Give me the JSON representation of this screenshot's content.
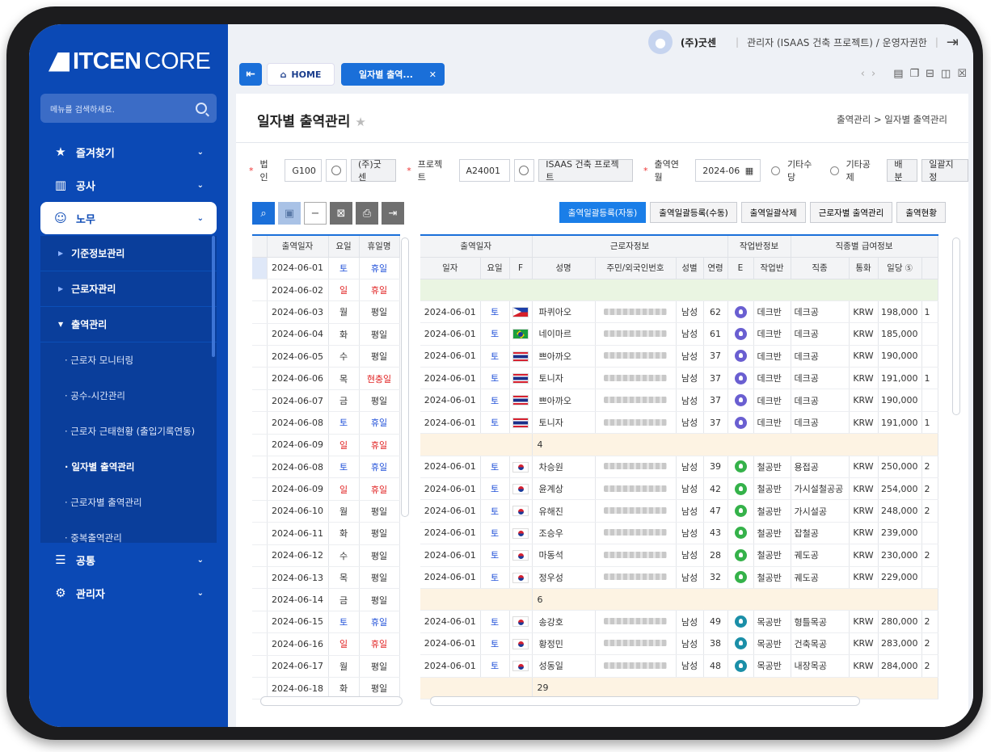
{
  "app": {
    "logo_main": "ITCEN",
    "logo_sub": "CORE"
  },
  "sidebar": {
    "search_placeholder": "메뉴를 검색하세요.",
    "items": [
      {
        "label": "즐겨찾기",
        "icon": "star-icon"
      },
      {
        "label": "공사",
        "icon": "building-icon"
      },
      {
        "label": "노무",
        "icon": "user-icon"
      },
      {
        "label": "공통",
        "icon": "common-icon"
      },
      {
        "label": "관리자",
        "icon": "folder-gear-icon"
      }
    ],
    "submenu": [
      {
        "label": "기준정보관리",
        "level": 1
      },
      {
        "label": "근로자관리",
        "level": 1
      },
      {
        "label": "출역관리",
        "level": 1,
        "open": true
      },
      {
        "label": "· 근로자 모니터링",
        "level": 2
      },
      {
        "label": "· 공수-시간관리",
        "level": 2
      },
      {
        "label": "· 근로자 근태현황 (출입기록연동)",
        "level": 2
      },
      {
        "label": "· 일자별 출역관리",
        "level": 2,
        "current": true
      },
      {
        "label": "· 근로자별 출역관리",
        "level": 2
      },
      {
        "label": "· 중복출역관리",
        "level": 2
      }
    ]
  },
  "topbar": {
    "company": "(주)굿센",
    "role": "관리자 (ISAAS 건축 프로젝트) / 운영자권한"
  },
  "tabs": {
    "home": "HOME",
    "active": "일자별 출역..."
  },
  "page": {
    "title": "일자별 출역관리",
    "breadcrumb": "출역관리 > 일자별 출역관리"
  },
  "filters": {
    "corp_label": "법인",
    "corp_code": "G100",
    "corp_name": "(주)굿센",
    "proj_label": "프로젝트",
    "proj_code": "A24001",
    "proj_name": "ISAAS 건축 프로젝트",
    "month_label": "출역연월",
    "month_value": "2024-06",
    "radio1": "기타수당",
    "radio2": "기타공제",
    "btn_distribute": "배분",
    "btn_bulk": "일괄지정"
  },
  "actions": [
    "출역일괄등록(자동)",
    "출역일괄등록(수동)",
    "출역일괄삭제",
    "근로자별 출역관리",
    "출역현황"
  ],
  "left_table": {
    "headers": [
      "출역일자",
      "요일",
      "휴일명"
    ],
    "rows": [
      [
        "2024-06-01",
        "토",
        "휴일"
      ],
      [
        "2024-06-02",
        "일",
        "휴일"
      ],
      [
        "2024-06-03",
        "월",
        "평일"
      ],
      [
        "2024-06-04",
        "화",
        "평일"
      ],
      [
        "2024-06-05",
        "수",
        "평일"
      ],
      [
        "2024-06-06",
        "목",
        "현충일"
      ],
      [
        "2024-06-07",
        "금",
        "평일"
      ],
      [
        "2024-06-08",
        "토",
        "휴일"
      ],
      [
        "2024-06-09",
        "일",
        "휴일"
      ],
      [
        "2024-06-08",
        "토",
        "휴일"
      ],
      [
        "2024-06-09",
        "일",
        "휴일"
      ],
      [
        "2024-06-10",
        "월",
        "평일"
      ],
      [
        "2024-06-11",
        "화",
        "평일"
      ],
      [
        "2024-06-12",
        "수",
        "평일"
      ],
      [
        "2024-06-13",
        "목",
        "평일"
      ],
      [
        "2024-06-14",
        "금",
        "평일"
      ],
      [
        "2024-06-15",
        "토",
        "휴일"
      ],
      [
        "2024-06-16",
        "일",
        "휴일"
      ],
      [
        "2024-06-17",
        "월",
        "평일"
      ],
      [
        "2024-06-18",
        "화",
        "평일"
      ]
    ]
  },
  "right_table": {
    "group_headers": [
      "출역일자",
      "근로자정보",
      "작업반정보",
      "직종별 급여정보"
    ],
    "headers": [
      "일자",
      "요일",
      "F",
      "성명",
      "주민/외국인번호",
      "성별",
      "연령",
      "E",
      "작업반",
      "직종",
      "통화",
      "일당"
    ],
    "rows": [
      {
        "type": "green"
      },
      {
        "type": "data",
        "date": "2024-06-01",
        "dow": "토",
        "flag": "ph",
        "name": "파퀴아오",
        "gender": "남성",
        "age": "62",
        "badge": "p",
        "team": "데크반",
        "job": "데크공",
        "cur": "KRW",
        "wage": "198,000",
        "extra": "1"
      },
      {
        "type": "data",
        "date": "2024-06-01",
        "dow": "토",
        "flag": "br",
        "name": "네이마르",
        "gender": "남성",
        "age": "61",
        "badge": "p",
        "team": "데크반",
        "job": "데크공",
        "cur": "KRW",
        "wage": "185,000",
        "extra": ""
      },
      {
        "type": "data",
        "date": "2024-06-01",
        "dow": "토",
        "flag": "th",
        "name": "쁘아까오",
        "gender": "남성",
        "age": "37",
        "badge": "p",
        "team": "데크반",
        "job": "데크공",
        "cur": "KRW",
        "wage": "190,000",
        "extra": ""
      },
      {
        "type": "data",
        "date": "2024-06-01",
        "dow": "토",
        "flag": "th",
        "name": "토니자",
        "gender": "남성",
        "age": "37",
        "badge": "p",
        "team": "데크반",
        "job": "데크공",
        "cur": "KRW",
        "wage": "191,000",
        "extra": "1"
      },
      {
        "type": "data",
        "date": "2024-06-01",
        "dow": "토",
        "flag": "th",
        "name": "쁘아까오",
        "gender": "남성",
        "age": "37",
        "badge": "p",
        "team": "데크반",
        "job": "데크공",
        "cur": "KRW",
        "wage": "190,000",
        "extra": ""
      },
      {
        "type": "data",
        "date": "2024-06-01",
        "dow": "토",
        "flag": "th",
        "name": "토니자",
        "gender": "남성",
        "age": "37",
        "badge": "p",
        "team": "데크반",
        "job": "데크공",
        "cur": "KRW",
        "wage": "191,000",
        "extra": "1"
      },
      {
        "type": "sum",
        "value": "4"
      },
      {
        "type": "data",
        "date": "2024-06-01",
        "dow": "토",
        "flag": "kr",
        "name": "차승원",
        "gender": "남성",
        "age": "39",
        "badge": "g",
        "team": "철공반",
        "job": "용접공",
        "cur": "KRW",
        "wage": "250,000",
        "extra": "2"
      },
      {
        "type": "data",
        "date": "2024-06-01",
        "dow": "토",
        "flag": "kr",
        "name": "윤계상",
        "gender": "남성",
        "age": "42",
        "badge": "g",
        "team": "철공반",
        "job": "가시설철공공",
        "cur": "KRW",
        "wage": "254,000",
        "extra": "2"
      },
      {
        "type": "data",
        "date": "2024-06-01",
        "dow": "토",
        "flag": "kr",
        "name": "유해진",
        "gender": "남성",
        "age": "47",
        "badge": "g",
        "team": "철공반",
        "job": "가시설공",
        "cur": "KRW",
        "wage": "248,000",
        "extra": "2"
      },
      {
        "type": "data",
        "date": "2024-06-01",
        "dow": "토",
        "flag": "kr",
        "name": "조승우",
        "gender": "남성",
        "age": "43",
        "badge": "g",
        "team": "철공반",
        "job": "잡철공",
        "cur": "KRW",
        "wage": "239,000",
        "extra": ""
      },
      {
        "type": "data",
        "date": "2024-06-01",
        "dow": "토",
        "flag": "kr",
        "name": "마동석",
        "gender": "남성",
        "age": "28",
        "badge": "g",
        "team": "철공반",
        "job": "궤도공",
        "cur": "KRW",
        "wage": "230,000",
        "extra": "2"
      },
      {
        "type": "data",
        "date": "2024-06-01",
        "dow": "토",
        "flag": "kr",
        "name": "정우성",
        "gender": "남성",
        "age": "32",
        "badge": "g",
        "team": "철공반",
        "job": "궤도공",
        "cur": "KRW",
        "wage": "229,000",
        "extra": ""
      },
      {
        "type": "sum",
        "value": "6"
      },
      {
        "type": "data",
        "date": "2024-06-01",
        "dow": "토",
        "flag": "kr",
        "name": "송강호",
        "gender": "남성",
        "age": "49",
        "badge": "t",
        "team": "목공반",
        "job": "형틀목공",
        "cur": "KRW",
        "wage": "280,000",
        "extra": "2"
      },
      {
        "type": "data",
        "date": "2024-06-01",
        "dow": "토",
        "flag": "kr",
        "name": "황정민",
        "gender": "남성",
        "age": "38",
        "badge": "t",
        "team": "목공반",
        "job": "건축목공",
        "cur": "KRW",
        "wage": "283,000",
        "extra": "2"
      },
      {
        "type": "data",
        "date": "2024-06-01",
        "dow": "토",
        "flag": "kr",
        "name": "성동일",
        "gender": "남성",
        "age": "48",
        "badge": "t",
        "team": "목공반",
        "job": "내장목공",
        "cur": "KRW",
        "wage": "284,000",
        "extra": "2"
      },
      {
        "type": "sum",
        "value": "29"
      }
    ]
  }
}
